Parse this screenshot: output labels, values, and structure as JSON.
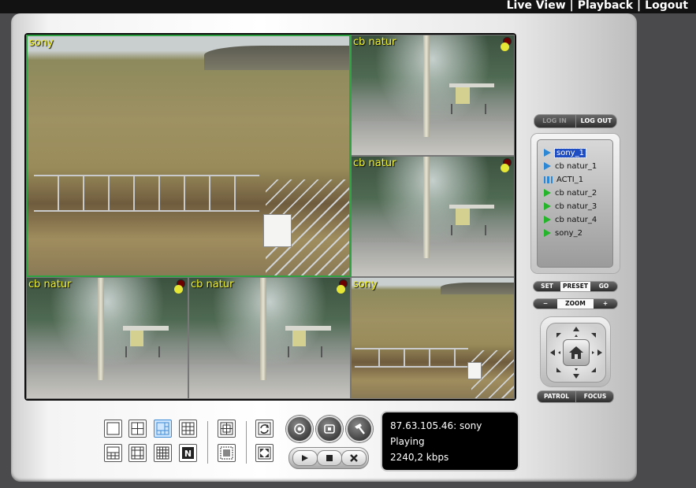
{
  "nav": {
    "live_view": "Live View",
    "playback": "Playback",
    "logout": "Logout",
    "separator": "|"
  },
  "tiles": [
    {
      "label": "sony"
    },
    {
      "label": "cb natur"
    },
    {
      "label": "cb natur"
    },
    {
      "label": "cb natur"
    },
    {
      "label": "cb natur"
    },
    {
      "label": "sony"
    }
  ],
  "login": {
    "login": "LOG IN",
    "logout": "LOG OUT"
  },
  "cameras": [
    {
      "name": "sony_1",
      "icon": "play-blue-icon",
      "selected": true
    },
    {
      "name": "cb natur_1",
      "icon": "play-blue-icon"
    },
    {
      "name": "ACTI_1",
      "icon": "axis-camera-icon"
    },
    {
      "name": "cb natur_2",
      "icon": "play-green-icon"
    },
    {
      "name": "cb natur_3",
      "icon": "play-green-icon"
    },
    {
      "name": "cb natur_4",
      "icon": "play-green-icon"
    },
    {
      "name": "sony_2",
      "icon": "play-green-icon"
    }
  ],
  "preset": {
    "set": "SET",
    "preset": "PRESET",
    "go": "GO"
  },
  "zoom": {
    "minus": "−",
    "label": "ZOOM",
    "plus": "+"
  },
  "ptz": {
    "patrol": "PATROL",
    "focus": "FOCUS"
  },
  "status": {
    "line1": "87.63.105.46: sony",
    "line2": "Playing",
    "line3": "2240,2 kbps"
  },
  "colors": {
    "selected_tile_border": "#2fa343",
    "tile_label": "#f3f31e",
    "highlight": "#1e4cc3"
  }
}
